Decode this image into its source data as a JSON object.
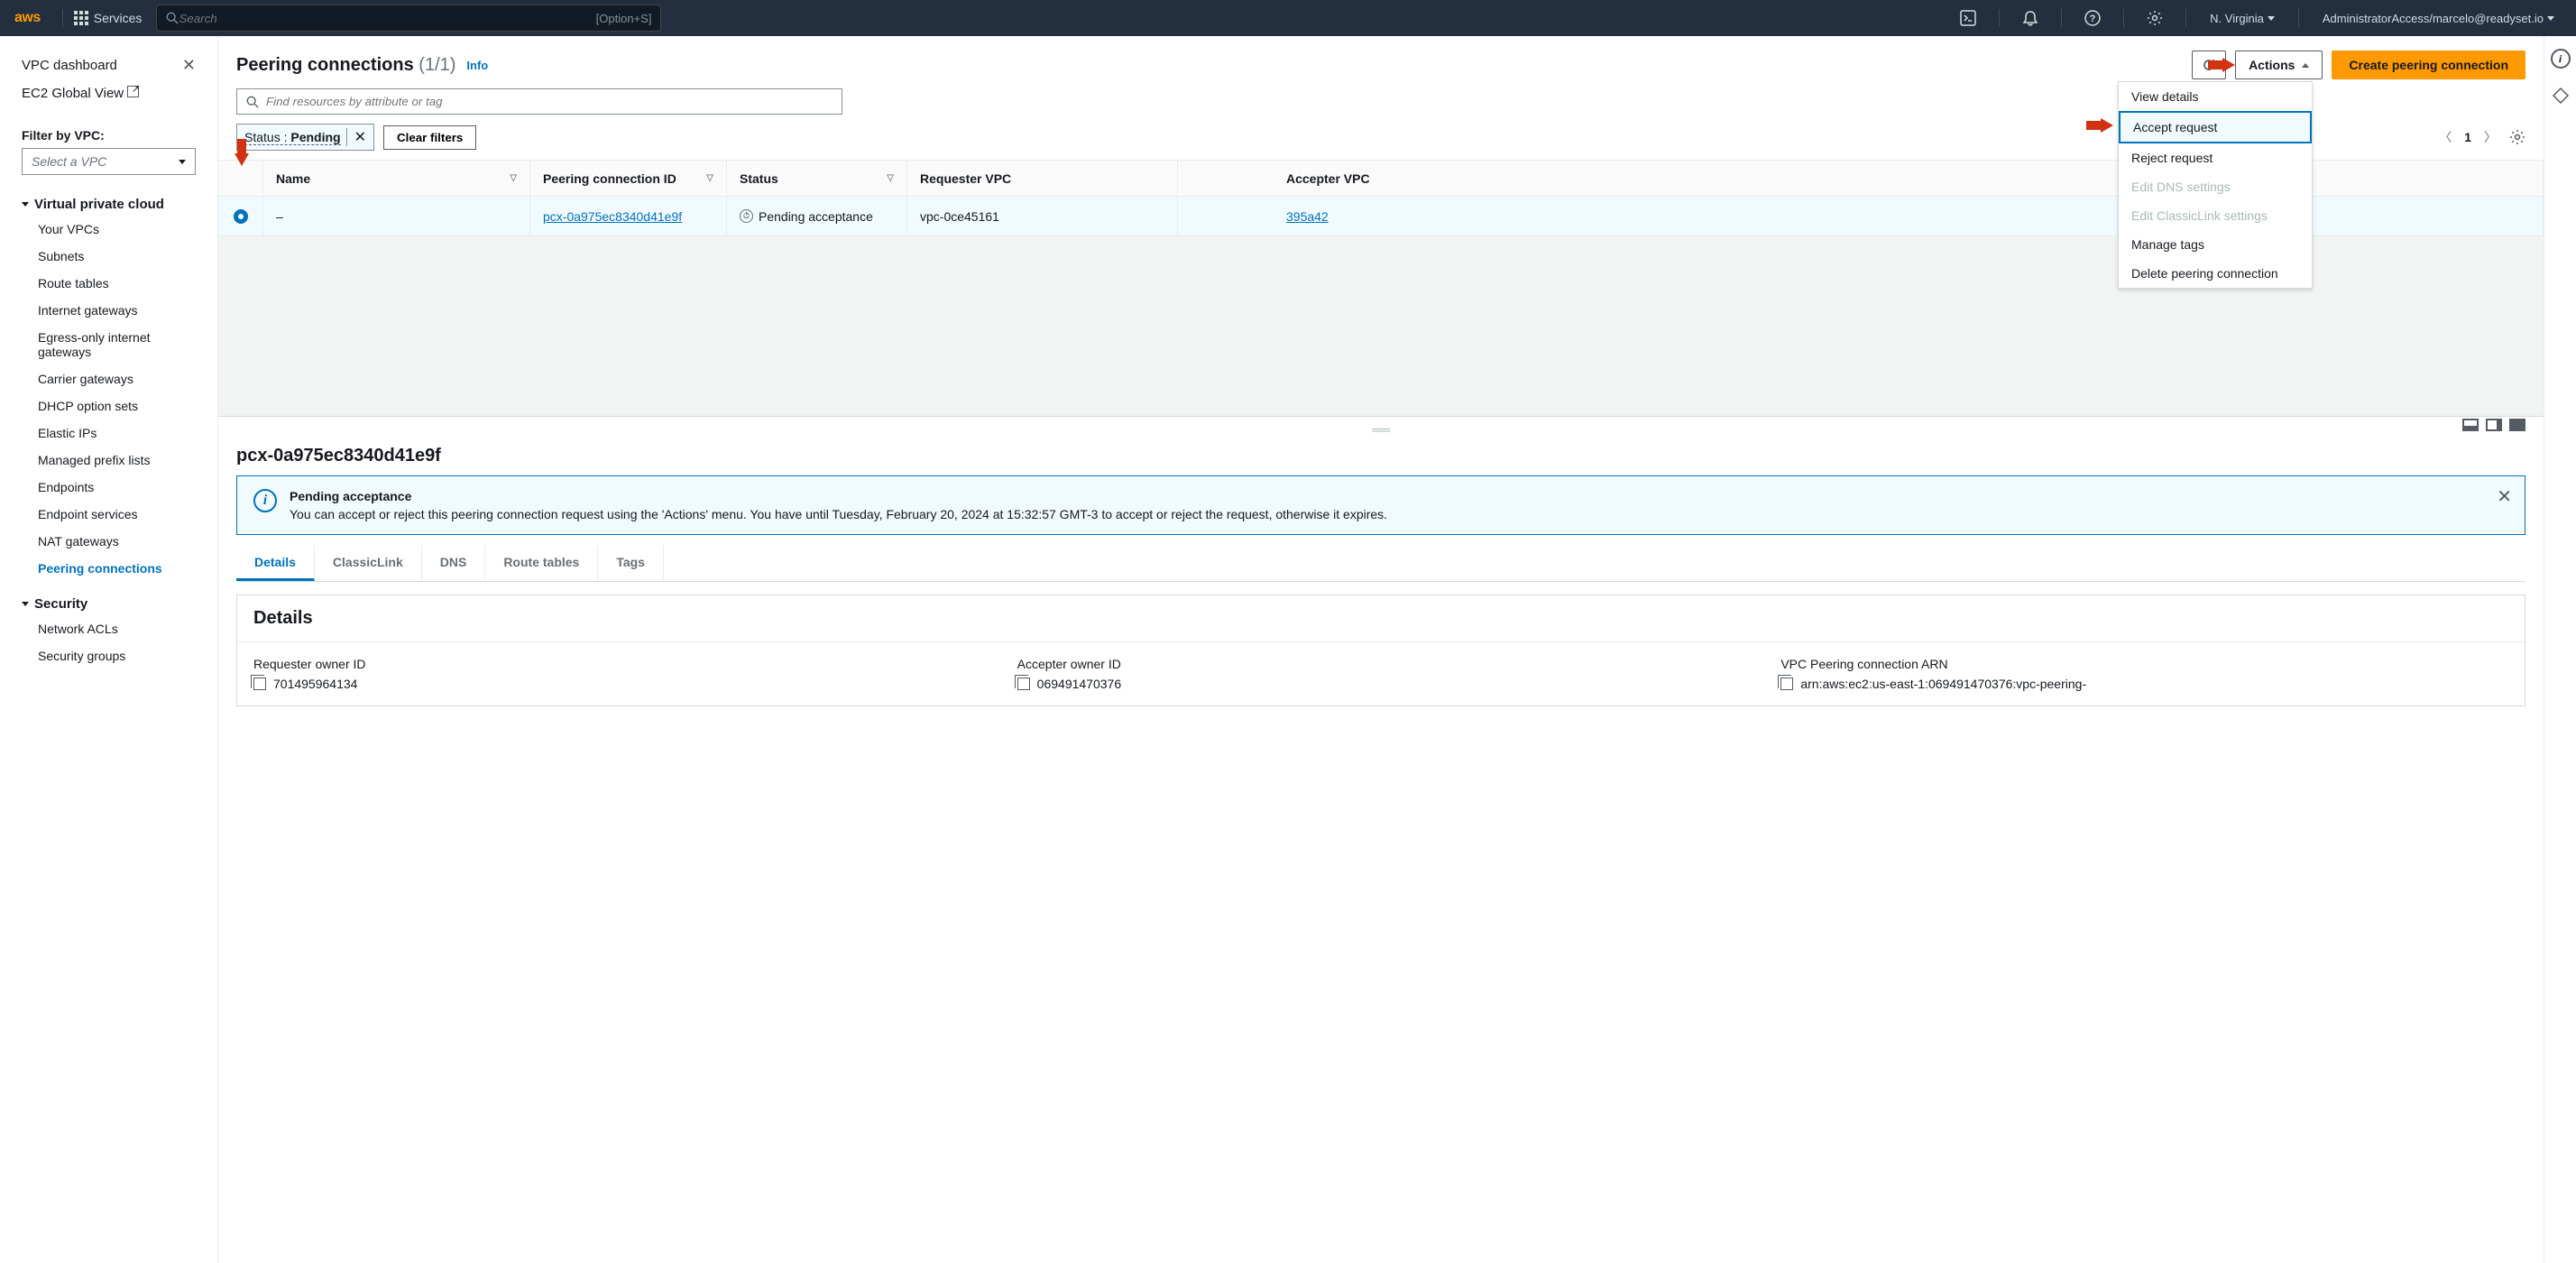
{
  "header": {
    "services": "Services",
    "search_placeholder": "Search",
    "search_shortcut": "[Option+S]",
    "region": "N. Virginia",
    "account": "AdministratorAccess/marcelo@readyset.io"
  },
  "sidebar": {
    "dashboard": "VPC dashboard",
    "ec2_global": "EC2 Global View",
    "filter_label": "Filter by VPC:",
    "vpc_placeholder": "Select a VPC",
    "sections": {
      "vpc": {
        "title": "Virtual private cloud",
        "items": [
          "Your VPCs",
          "Subnets",
          "Route tables",
          "Internet gateways",
          "Egress-only internet gateways",
          "Carrier gateways",
          "DHCP option sets",
          "Elastic IPs",
          "Managed prefix lists",
          "Endpoints",
          "Endpoint services",
          "NAT gateways",
          "Peering connections"
        ]
      },
      "security": {
        "title": "Security",
        "items": [
          "Network ACLs",
          "Security groups"
        ]
      }
    }
  },
  "page": {
    "title": "Peering connections",
    "count": "(1/1)",
    "info": "Info",
    "actions_btn": "Actions",
    "create_btn": "Create peering connection",
    "filter_placeholder": "Find resources by attribute or tag",
    "chip_key": "Status :",
    "chip_val": "Pending",
    "clear": "Clear filters",
    "page_num": "1"
  },
  "actions_menu": [
    "View details",
    "Accept request",
    "Reject request",
    "Edit DNS settings",
    "Edit ClassicLink settings",
    "Manage tags",
    "Delete peering connection"
  ],
  "table": {
    "headers": [
      "Name",
      "Peering connection ID",
      "Status",
      "Requester VPC",
      "Accepter VPC"
    ],
    "row": {
      "name": "–",
      "id": "pcx-0a975ec8340d41e9f",
      "status": "Pending acceptance",
      "requester": "vpc-0ce45161",
      "accepter": "395a42"
    }
  },
  "detail": {
    "title": "pcx-0a975ec8340d41e9f",
    "banner_title": "Pending acceptance",
    "banner_body": "You can accept or reject this peering connection request using the 'Actions' menu. You have until Tuesday, February 20, 2024 at 15:32:57 GMT-3 to accept or reject the request, otherwise it expires.",
    "tabs": [
      "Details",
      "ClassicLink",
      "DNS",
      "Route tables",
      "Tags"
    ],
    "box_title": "Details",
    "fields": {
      "req_owner_label": "Requester owner ID",
      "req_owner_val": "701495964134",
      "acc_owner_label": "Accepter owner ID",
      "acc_owner_val": "069491470376",
      "arn_label": "VPC Peering connection ARN",
      "arn_val": "arn:aws:ec2:us-east-1:069491470376:vpc-peering-"
    }
  }
}
